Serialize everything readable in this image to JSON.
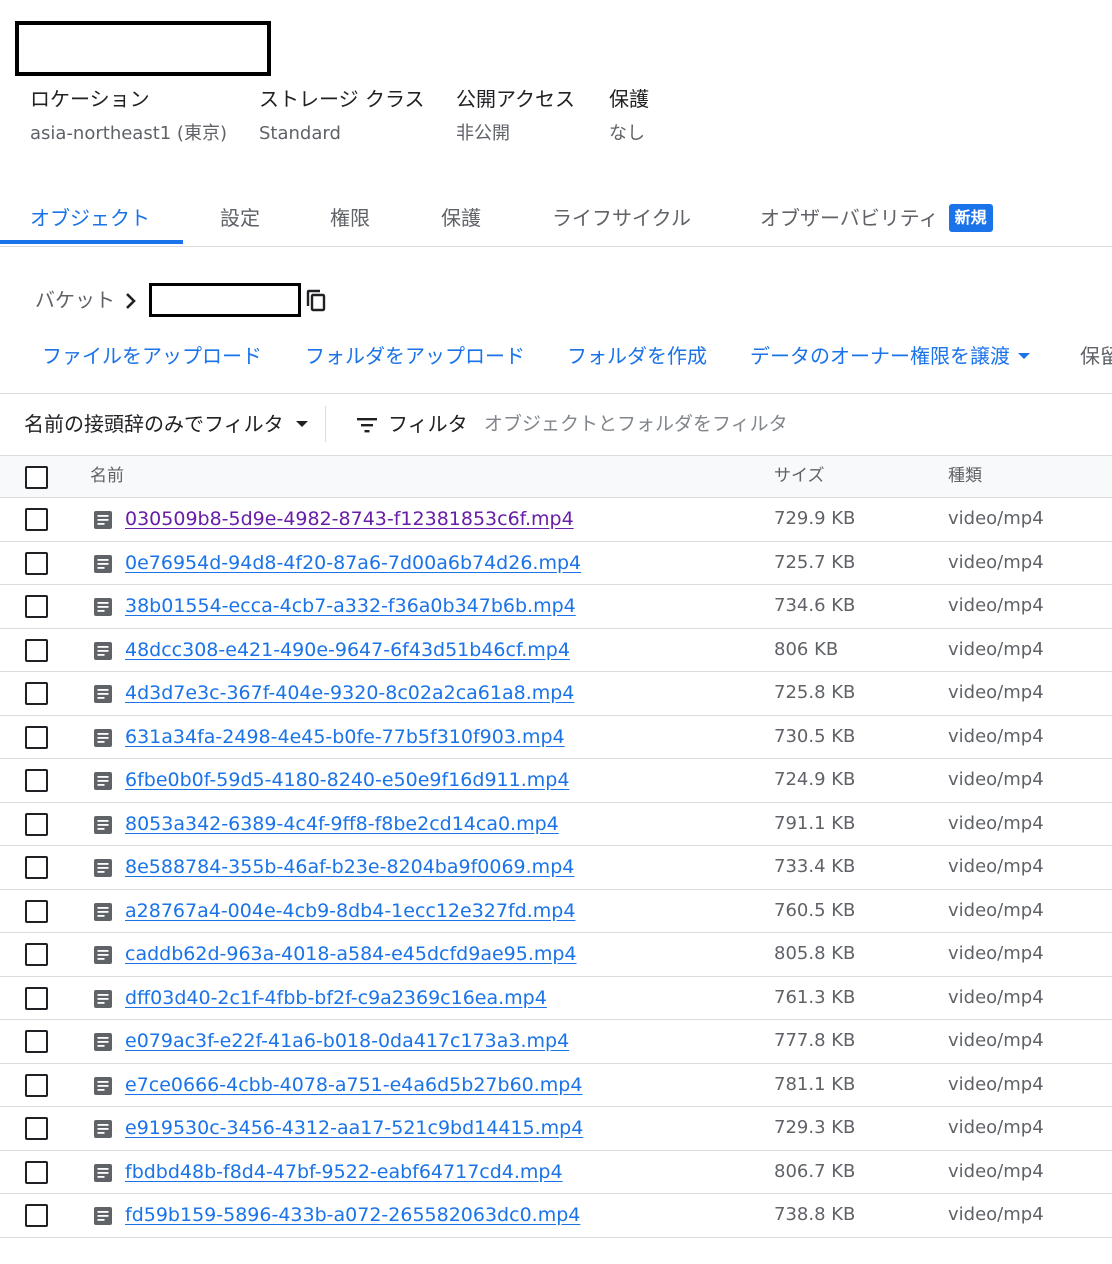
{
  "bucket_info": [
    {
      "label": "ロケーション",
      "value": "asia-northeast1 (東京)"
    },
    {
      "label": "ストレージ クラス",
      "value": "Standard"
    },
    {
      "label": "公開アクセス",
      "value": "非公開"
    },
    {
      "label": "保護",
      "value": "なし"
    }
  ],
  "tabs": [
    {
      "label": "オブジェクト",
      "active": true
    },
    {
      "label": "設定"
    },
    {
      "label": "権限"
    },
    {
      "label": "保護"
    },
    {
      "label": "ライフサイクル"
    },
    {
      "label": "オブザーバビリティ",
      "badge": "新規"
    }
  ],
  "breadcrumb": {
    "root": "バケット"
  },
  "actions": [
    {
      "label": "ファイルをアップロード"
    },
    {
      "label": "フォルダをアップロード"
    },
    {
      "label": "フォルダを作成"
    },
    {
      "label": "データのオーナー権限を譲渡"
    },
    {
      "label": "保留"
    }
  ],
  "filter": {
    "prefix_label": "名前の接頭辞のみでフィルタ",
    "label": "フィルタ",
    "placeholder": "オブジェクトとフォルダをフィルタ"
  },
  "table": {
    "headers": {
      "name": "名前",
      "size": "サイズ",
      "type": "種類"
    },
    "rows": [
      {
        "name": "030509b8-5d9e-4982-8743-f12381853c6f.mp4",
        "size": "729.9 KB",
        "type": "video/mp4",
        "visited": true
      },
      {
        "name": "0e76954d-94d8-4f20-87a6-7d00a6b74d26.mp4",
        "size": "725.7 KB",
        "type": "video/mp4"
      },
      {
        "name": "38b01554-ecca-4cb7-a332-f36a0b347b6b.mp4",
        "size": "734.6 KB",
        "type": "video/mp4"
      },
      {
        "name": "48dcc308-e421-490e-9647-6f43d51b46cf.mp4",
        "size": "806 KB",
        "type": "video/mp4"
      },
      {
        "name": "4d3d7e3c-367f-404e-9320-8c02a2ca61a8.mp4",
        "size": "725.8 KB",
        "type": "video/mp4"
      },
      {
        "name": "631a34fa-2498-4e45-b0fe-77b5f310f903.mp4",
        "size": "730.5 KB",
        "type": "video/mp4"
      },
      {
        "name": "6fbe0b0f-59d5-4180-8240-e50e9f16d911.mp4",
        "size": "724.9 KB",
        "type": "video/mp4"
      },
      {
        "name": "8053a342-6389-4c4f-9ff8-f8be2cd14ca0.mp4",
        "size": "791.1 KB",
        "type": "video/mp4"
      },
      {
        "name": "8e588784-355b-46af-b23e-8204ba9f0069.mp4",
        "size": "733.4 KB",
        "type": "video/mp4"
      },
      {
        "name": "a28767a4-004e-4cb9-8db4-1ecc12e327fd.mp4",
        "size": "760.5 KB",
        "type": "video/mp4"
      },
      {
        "name": "caddb62d-963a-4018-a584-e45dcfd9ae95.mp4",
        "size": "805.8 KB",
        "type": "video/mp4"
      },
      {
        "name": "dff03d40-2c1f-4fbb-bf2f-c9a2369c16ea.mp4",
        "size": "761.3 KB",
        "type": "video/mp4"
      },
      {
        "name": "e079ac3f-e22f-41a6-b018-0da417c173a3.mp4",
        "size": "777.8 KB",
        "type": "video/mp4"
      },
      {
        "name": "e7ce0666-4cbb-4078-a751-e4a6d5b27b60.mp4",
        "size": "781.1 KB",
        "type": "video/mp4"
      },
      {
        "name": "e919530c-3456-4312-aa17-521c9bd14415.mp4",
        "size": "729.3 KB",
        "type": "video/mp4"
      },
      {
        "name": "fbdbd48b-f8d4-47bf-9522-eabf64717cd4.mp4",
        "size": "806.7 KB",
        "type": "video/mp4"
      },
      {
        "name": "fd59b159-5896-433b-a072-265582063dc0.mp4",
        "size": "738.8 KB",
        "type": "video/mp4"
      }
    ]
  },
  "colors": {
    "accent": "#1a73e8",
    "visited_link": "#681da8",
    "muted_text": "#5f6368",
    "divider": "#dadce0"
  }
}
